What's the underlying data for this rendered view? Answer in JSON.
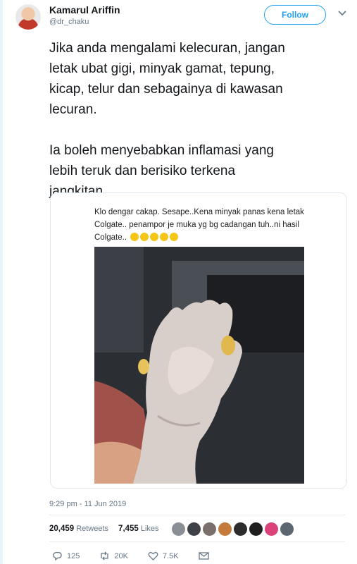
{
  "author": {
    "name": "Kamarul Ariffin",
    "handle": "@dr_chaku"
  },
  "follow_label": "Follow",
  "tweet": {
    "paragraph_1": "Jika anda mengalami kelecuran, jangan\nletak ubat gigi, minyak gamat, tepung,\nkicap, telur dan sebagainya di kawasan\nlecuran.",
    "paragraph_2": "Ia boleh menyebabkan inflamasi yang\nlebih teruk dan berisiko terkena\njangkitan."
  },
  "media": {
    "caption": "Klo dengar cakap. Sesape..Kena minyak panas kena letak Colgate.. penampor je muka yg bg cadangan tuh..ni hasil Colgate..",
    "caption_emoji_count": 5
  },
  "timestamp": "9:29 pm - 11 Jun 2019",
  "stats": {
    "retweets_count": "20,459",
    "retweets_label": "Retweets",
    "likes_count": "7,455",
    "likes_label": "Likes"
  },
  "likers_count": 9,
  "actions": {
    "replies": "125",
    "retweets": "20K",
    "likes": "7.5K"
  },
  "colors": {
    "accent": "#1da1f2",
    "secondary_text": "#657786",
    "divider": "#e6ecf0"
  }
}
